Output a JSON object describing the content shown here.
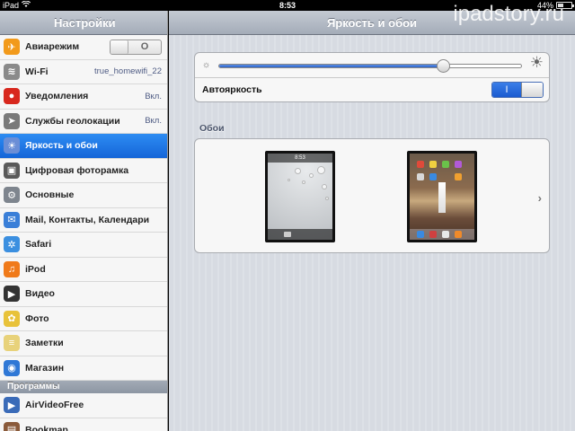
{
  "status_bar": {
    "device": "iPad",
    "time": "8:53",
    "battery_percent": "44%",
    "battery_level": 0.44
  },
  "watermark": "ipadstory.ru",
  "sidebar": {
    "title": "Настройки",
    "items": [
      {
        "label": "Авиарежим",
        "icon": "airplane-icon",
        "icon_color": "#f29a1b",
        "toggle": "O"
      },
      {
        "label": "Wi-Fi",
        "icon": "wifi-icon",
        "icon_color": "#8a8a8a",
        "value": "true_homewifi_22"
      },
      {
        "label": "Уведомления",
        "icon": "notifications-icon",
        "icon_color": "#d8281e",
        "value": "Вкл."
      },
      {
        "label": "Службы геолокации",
        "icon": "location-icon",
        "icon_color": "#7a7a7a",
        "value": "Вкл."
      },
      {
        "label": "Яркость и обои",
        "icon": "brightness-icon",
        "icon_color": "#6b8ed6",
        "selected": true
      },
      {
        "label": "Цифровая фоторамка",
        "icon": "photo-frame-icon",
        "icon_color": "#5a5a5a"
      },
      {
        "label": "Основные",
        "icon": "gear-icon",
        "icon_color": "#7e858e"
      },
      {
        "label": "Mail, Контакты, Календари",
        "icon": "mail-icon",
        "icon_color": "#3a7fd8"
      },
      {
        "label": "Safari",
        "icon": "safari-icon",
        "icon_color": "#3b8fe0"
      },
      {
        "label": "iPod",
        "icon": "ipod-icon",
        "icon_color": "#f07a1a"
      },
      {
        "label": "Видео",
        "icon": "video-icon",
        "icon_color": "#333333"
      },
      {
        "label": "Фото",
        "icon": "photos-icon",
        "icon_color": "#e8c23a"
      },
      {
        "label": "Заметки",
        "icon": "notes-icon",
        "icon_color": "#e8d27a"
      },
      {
        "label": "Магазин",
        "icon": "store-icon",
        "icon_color": "#2f78d6"
      }
    ],
    "section_header": "Программы",
    "app_items": [
      {
        "label": "AirVideoFree",
        "icon": "airvideo-icon",
        "icon_color": "#3a6bb8"
      },
      {
        "label": "Bookmap",
        "icon": "bookmap-icon",
        "icon_color": "#8a5a3a"
      }
    ]
  },
  "main": {
    "title": "Яркость и обои",
    "brightness_level": 0.74,
    "auto_brightness_label": "Автояркость",
    "auto_brightness_state": "I",
    "wallpaper_section": "Обои",
    "lock_screen_time": "8:53"
  }
}
